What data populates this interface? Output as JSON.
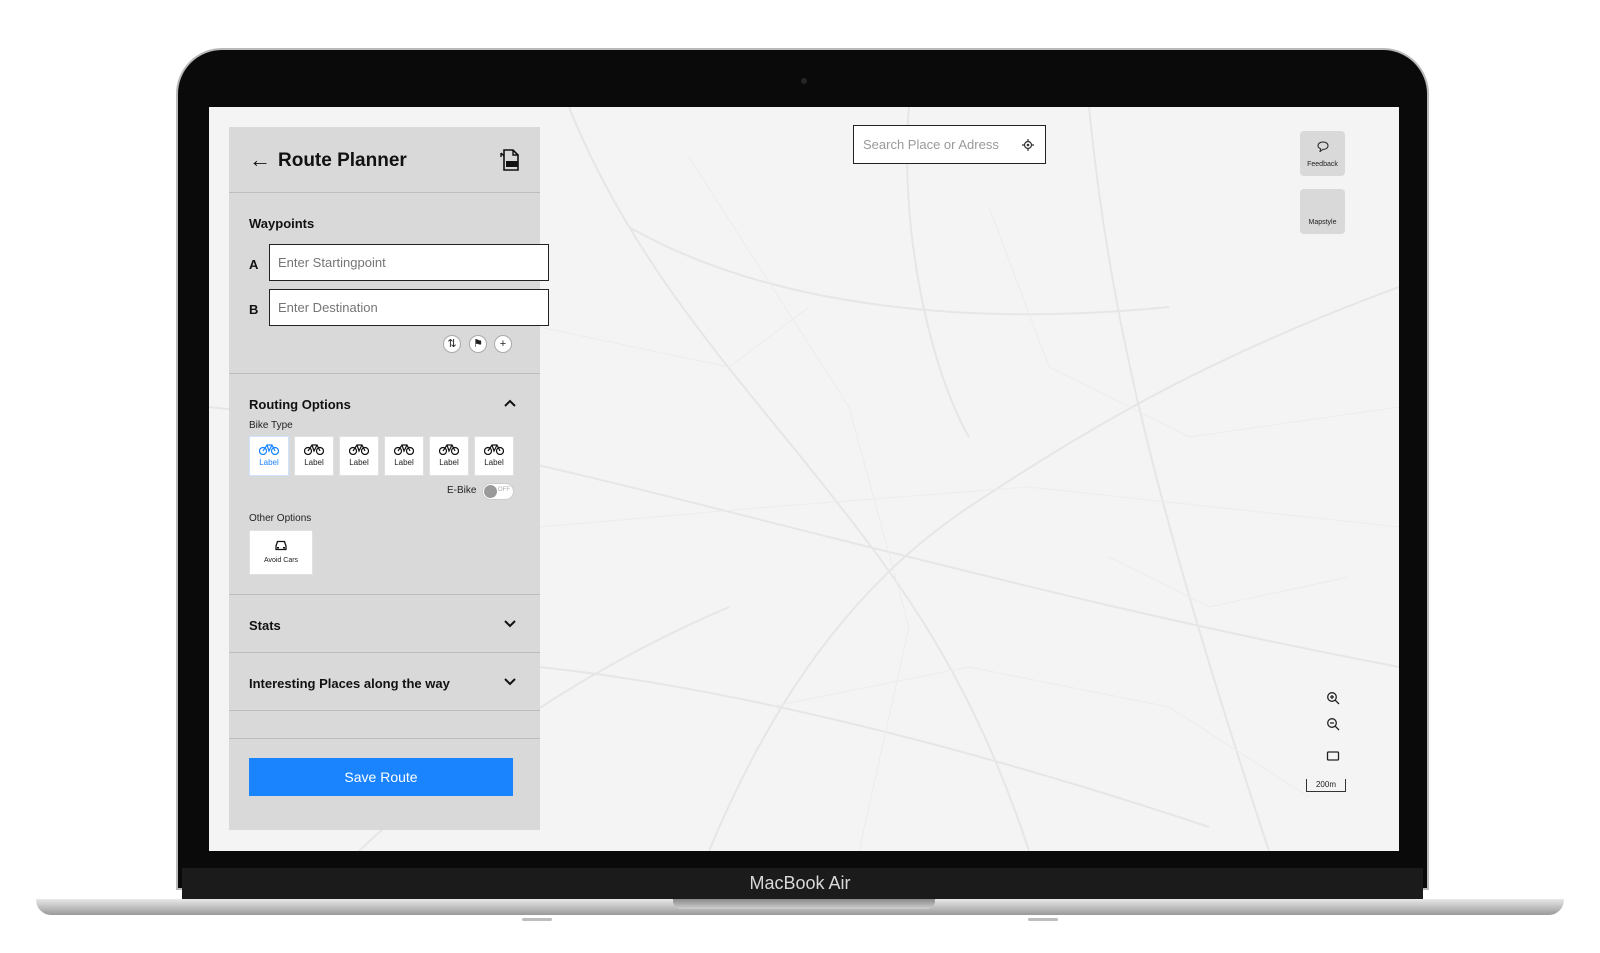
{
  "device": {
    "brand_label": "MacBook Air"
  },
  "panel": {
    "title": "Route Planner",
    "waypoints": {
      "heading": "Waypoints",
      "a_letter": "A",
      "b_letter": "B",
      "start_placeholder": "Enter Startingpoint",
      "dest_placeholder": "Enter Destination"
    },
    "routing": {
      "heading": "Routing Options",
      "bike_type_label": "Bike Type",
      "bike_types": [
        "Label",
        "Label",
        "Label",
        "Label",
        "Label",
        "Label"
      ],
      "ebike_label": "E-Bike",
      "toggle_state": "OFF",
      "other_label": "Other Options",
      "avoid_cars_label": "Avoid Cars"
    },
    "stats_heading": "Stats",
    "places_heading": "Interesting Places along the way",
    "save_label": "Save Route"
  },
  "search": {
    "placeholder": "Search Place or Adress"
  },
  "side_buttons": {
    "feedback": "Feedback",
    "mapstyle": "Mapstyle"
  },
  "scale_label": "200m",
  "colors": {
    "accent": "#1a84ff",
    "panel_bg": "#d9d9d9",
    "map_bg": "#f4f4f4"
  }
}
